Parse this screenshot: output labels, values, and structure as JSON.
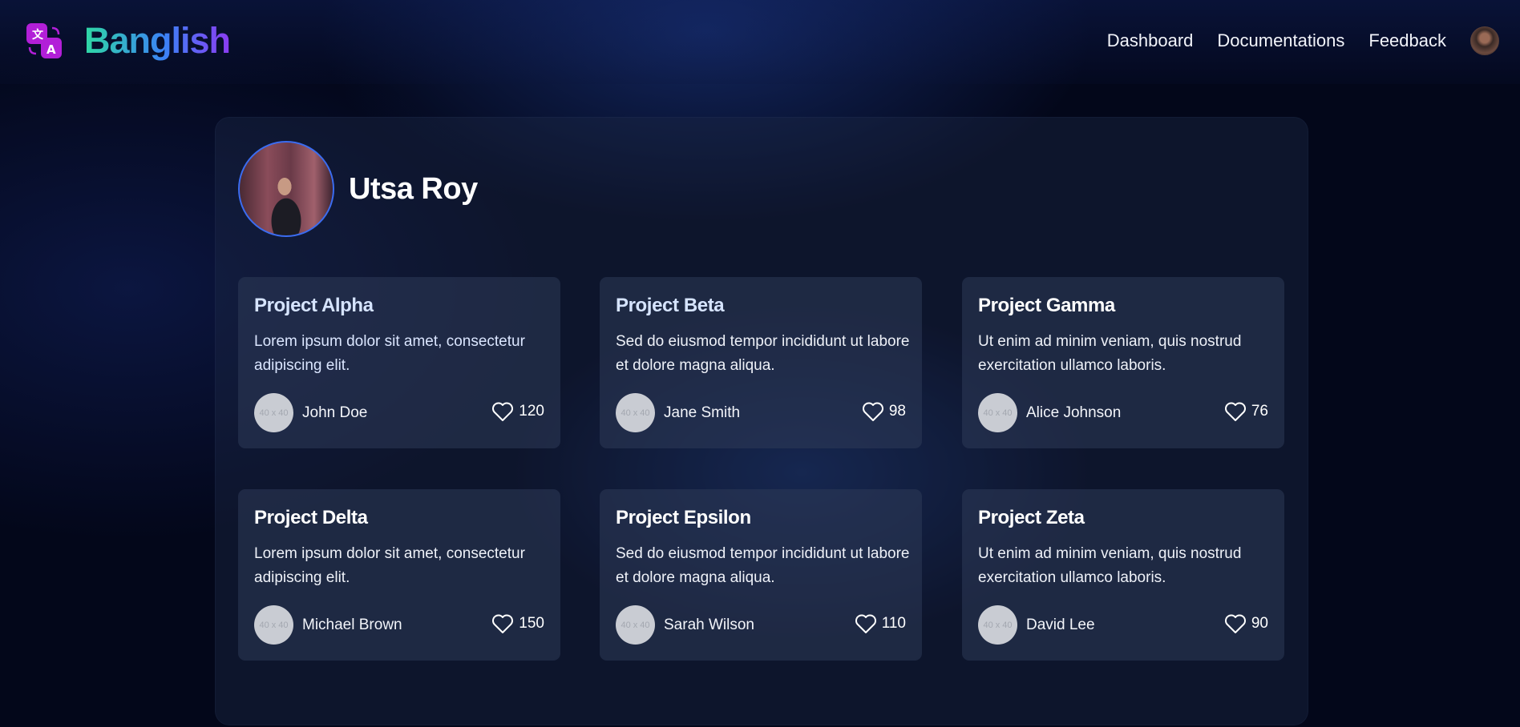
{
  "brand": {
    "name": "Banglish",
    "icon": "translate-icon",
    "gradient": [
      "#2fd8a4",
      "#3b82f6",
      "#8b3cf2"
    ]
  },
  "nav": {
    "items": [
      {
        "label": "Dashboard"
      },
      {
        "label": "Documentations"
      },
      {
        "label": "Feedback"
      }
    ],
    "avatar": "user-avatar"
  },
  "profile": {
    "name": "Utsa Roy",
    "accent_color": "#3b6cf0"
  },
  "projects": [
    {
      "title": "Project Alpha",
      "description": "Lorem ipsum dolor sit amet, consectetur adipiscing elit.",
      "author": "John Doe",
      "avatar_placeholder": "40 x 40",
      "likes": "120"
    },
    {
      "title": "Project Beta",
      "description": "Sed do eiusmod tempor incididunt ut labore et dolore magna aliqua.",
      "author": "Jane Smith",
      "avatar_placeholder": "40 x 40",
      "likes": "98"
    },
    {
      "title": "Project Gamma",
      "description": "Ut enim ad minim veniam, quis nostrud exercitation ullamco laboris.",
      "author": "Alice Johnson",
      "avatar_placeholder": "40 x 40",
      "likes": "76"
    },
    {
      "title": "Project Delta",
      "description": "Lorem ipsum dolor sit amet, consectetur adipiscing elit.",
      "author": "Michael Brown",
      "avatar_placeholder": "40 x 40",
      "likes": "150"
    },
    {
      "title": "Project Epsilon",
      "description": "Sed do eiusmod tempor incididunt ut labore et dolore magna aliqua.",
      "author": "Sarah Wilson",
      "avatar_placeholder": "40 x 40",
      "likes": "110"
    },
    {
      "title": "Project Zeta",
      "description": "Ut enim ad minim veniam, quis nostrud exercitation ullamco laboris.",
      "author": "David Lee",
      "avatar_placeholder": "40 x 40",
      "likes": "90"
    }
  ]
}
